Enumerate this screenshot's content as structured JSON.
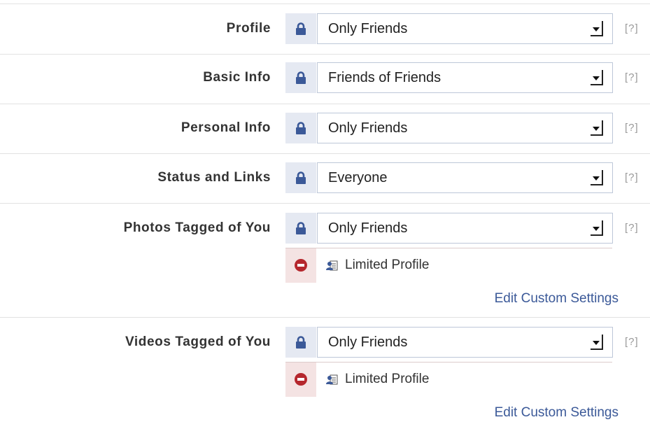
{
  "settings": [
    {
      "label": "Profile",
      "value": "Only Friends",
      "help": "[?]"
    },
    {
      "label": "Basic Info",
      "value": "Friends of Friends",
      "help": "[?]"
    },
    {
      "label": "Personal Info",
      "value": "Only Friends",
      "help": "[?]"
    },
    {
      "label": "Status and Links",
      "value": "Everyone",
      "help": "[?]"
    },
    {
      "label": "Photos Tagged of You",
      "value": "Only Friends",
      "help": "[?]",
      "exception": "Limited Profile",
      "edit_link": "Edit Custom Settings"
    },
    {
      "label": "Videos Tagged of You",
      "value": "Only Friends",
      "help": "[?]",
      "exception": "Limited Profile",
      "edit_link": "Edit Custom Settings"
    }
  ],
  "icons": {
    "lock": "lock-icon",
    "deny": "deny-icon",
    "list": "friend-list-icon",
    "dropdown": "chevron-down-icon"
  },
  "colors": {
    "lock": "#3b5998",
    "deny": "#b5272d",
    "link": "#3b5998",
    "lock_bg": "#e5e9f2",
    "deny_bg": "#f4e3e3"
  }
}
